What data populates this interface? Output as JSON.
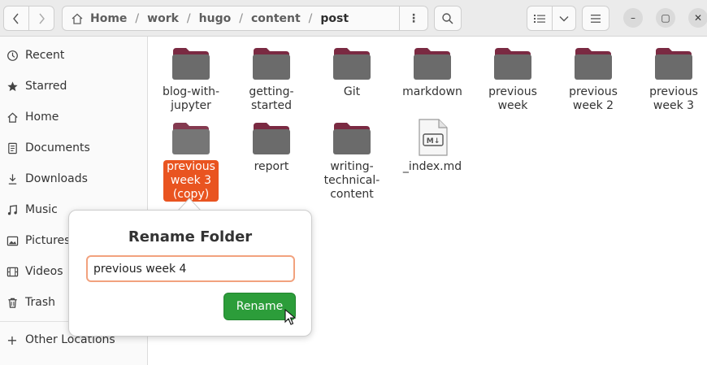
{
  "toolbar": {
    "back_icon": "chevron-left-icon",
    "forward_icon": "chevron-right-icon",
    "path_menu_glyph": "⋮",
    "search_icon": "search-icon",
    "view_list_icon": "list-view-icon",
    "view_dropdown_icon": "chevron-down-icon",
    "main_menu_icon": "hamburger-menu-icon"
  },
  "breadcrumbs": [
    "Home",
    "work",
    "hugo",
    "content",
    "post"
  ],
  "window_controls": {
    "minimize_glyph": "–",
    "maximize_glyph": "▢",
    "close_glyph": "✕"
  },
  "sidebar": {
    "items": [
      {
        "label": "Recent",
        "icon": "clock-icon"
      },
      {
        "label": "Starred",
        "icon": "star-icon"
      },
      {
        "label": "Home",
        "icon": "home-icon"
      },
      {
        "label": "Documents",
        "icon": "document-icon"
      },
      {
        "label": "Downloads",
        "icon": "download-icon"
      },
      {
        "label": "Music",
        "icon": "music-icon"
      },
      {
        "label": "Pictures",
        "icon": "picture-icon"
      },
      {
        "label": "Videos",
        "icon": "video-icon"
      },
      {
        "label": "Trash",
        "icon": "trash-icon"
      }
    ],
    "other_locations": "Other Locations",
    "other_locations_glyph": "+"
  },
  "files": [
    {
      "name": "blog-with-\njupyter",
      "type": "folder"
    },
    {
      "name": "getting-\nstarted",
      "type": "folder"
    },
    {
      "name": "Git",
      "type": "folder"
    },
    {
      "name": "markdown",
      "type": "folder"
    },
    {
      "name": "previous\nweek",
      "type": "folder"
    },
    {
      "name": "previous\nweek 2",
      "type": "folder"
    },
    {
      "name": "previous\nweek 3",
      "type": "folder"
    },
    {
      "name": "previous\nweek 3\n(copy)",
      "type": "folder",
      "selected": true
    },
    {
      "name": "report",
      "type": "folder"
    },
    {
      "name": "writing-\ntechnical-\ncontent",
      "type": "folder"
    },
    {
      "name": "_index.md",
      "type": "markdown",
      "badge": "M↓"
    }
  ],
  "rename_dialog": {
    "title": "Rename Folder",
    "input_value": "previous week 4",
    "button_label": "Rename"
  },
  "colors": {
    "accent": "#e95420",
    "folder_body": "#6b6b6b",
    "folder_tab": "#7a2a42",
    "rename_button": "#2c9d3a"
  }
}
